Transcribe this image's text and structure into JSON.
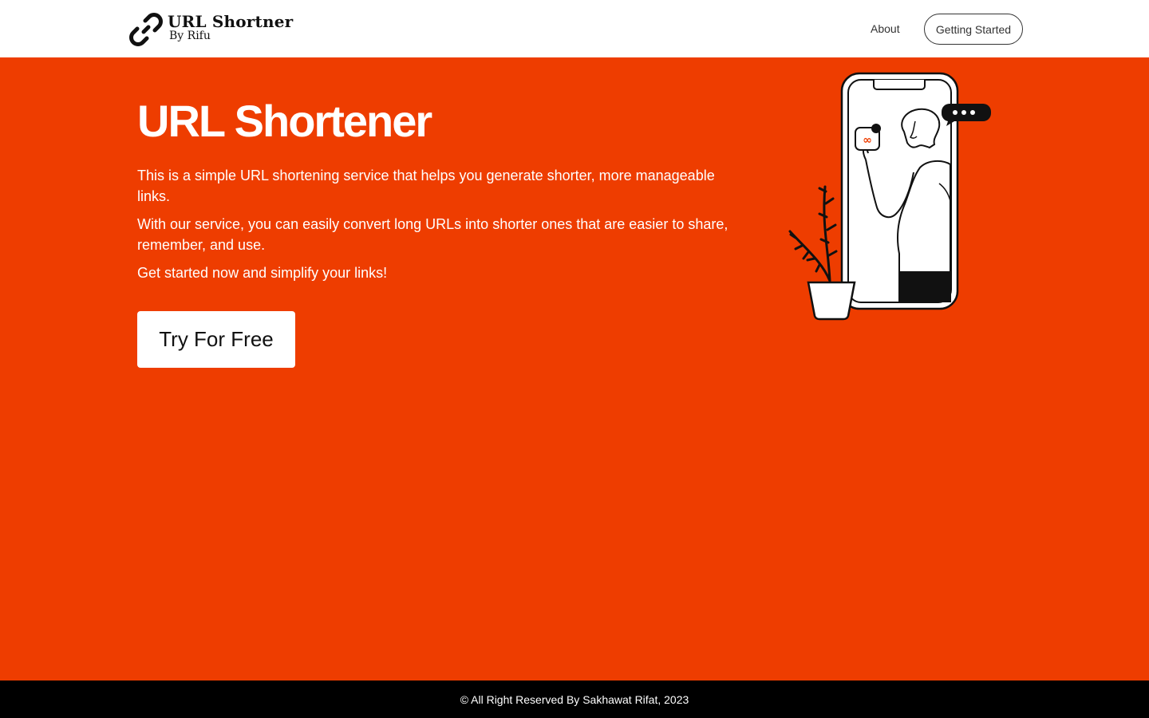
{
  "navbar": {
    "brand_title": "URL Shortner",
    "brand_subtitle": "By Rifu",
    "brand_icon": "link-icon",
    "links": [
      {
        "label": "About"
      },
      {
        "label": "Getting Started"
      }
    ]
  },
  "hero": {
    "title": "URL Shortener",
    "paragraphs": [
      "This is a simple URL shortening service that helps you generate shorter, more manageable links.",
      "With our service, you can easily convert long URLs into shorter ones that are easier to share, remember, and use.",
      "Get started now and simplify your links!"
    ],
    "cta_label": "Try For Free",
    "illustration": "person-in-phone-with-plant"
  },
  "footer": {
    "copyright": "© All Right Reserved By Sakhawat Rifat, 2023"
  },
  "colors": {
    "accent": "#ee3d00",
    "navbar_bg": "#ffffff",
    "footer_bg": "#000000",
    "text_light": "#ffffff"
  }
}
